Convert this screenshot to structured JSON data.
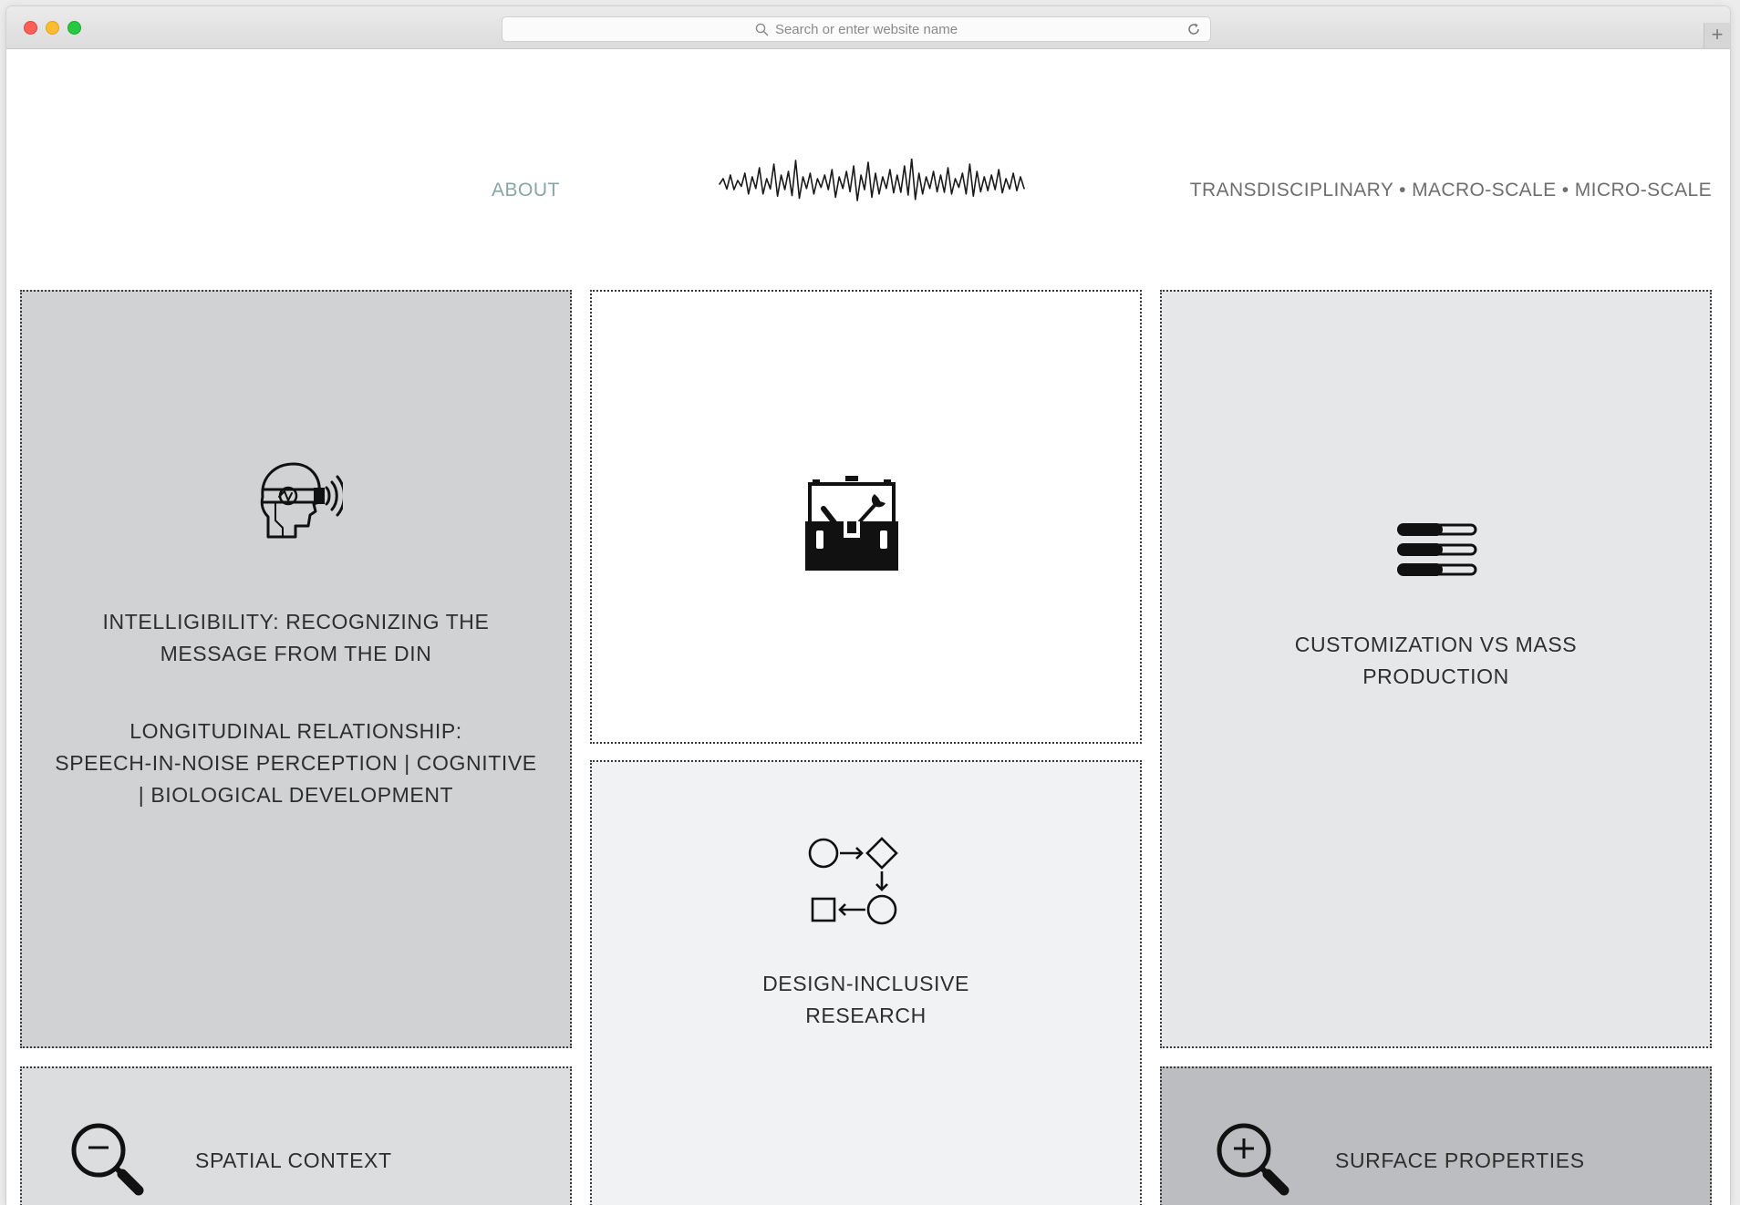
{
  "browser": {
    "url_placeholder": "Search or enter website name",
    "new_tab_label": "+"
  },
  "nav": {
    "about": "ABOUT",
    "tagline": "TRANSDISCIPLINARY • MACRO-SCALE • MICRO-SCALE",
    "logo_icon": "sound-waveform-icon"
  },
  "tiles": {
    "intelligibility": {
      "icon": "head-listening-icon",
      "line1": "INTELLIGIBILITY: RECOGNIZING THE",
      "line2": "MESSAGE FROM THE DIN",
      "line3": "LONGITUDINAL RELATIONSHIP:",
      "line4": "SPEECH-IN-NOISE PERCEPTION | COGNITIVE",
      "line5": "| BIOLOGICAL DEVELOPMENT",
      "bg": "#d1d2d4"
    },
    "toolbox": {
      "icon": "toolbox-icon",
      "bg": "#ffffff"
    },
    "customization": {
      "icon": "tubes-icon",
      "line1": "CUSTOMIZATION VS MASS",
      "line2": "PRODUCTION",
      "bg": "#e6e7e8"
    },
    "design": {
      "icon": "process-flow-icon",
      "line1": "DESIGN-INCLUSIVE",
      "line2": "RESEARCH",
      "bg": "#f1f2f3"
    },
    "spatial": {
      "icon": "zoom-out-icon",
      "label": "SPATIAL CONTEXT",
      "bg": "#dcdddf"
    },
    "surface": {
      "icon": "zoom-in-icon",
      "label": "SURFACE PROPERTIES",
      "bg": "#bcbdc0"
    }
  }
}
